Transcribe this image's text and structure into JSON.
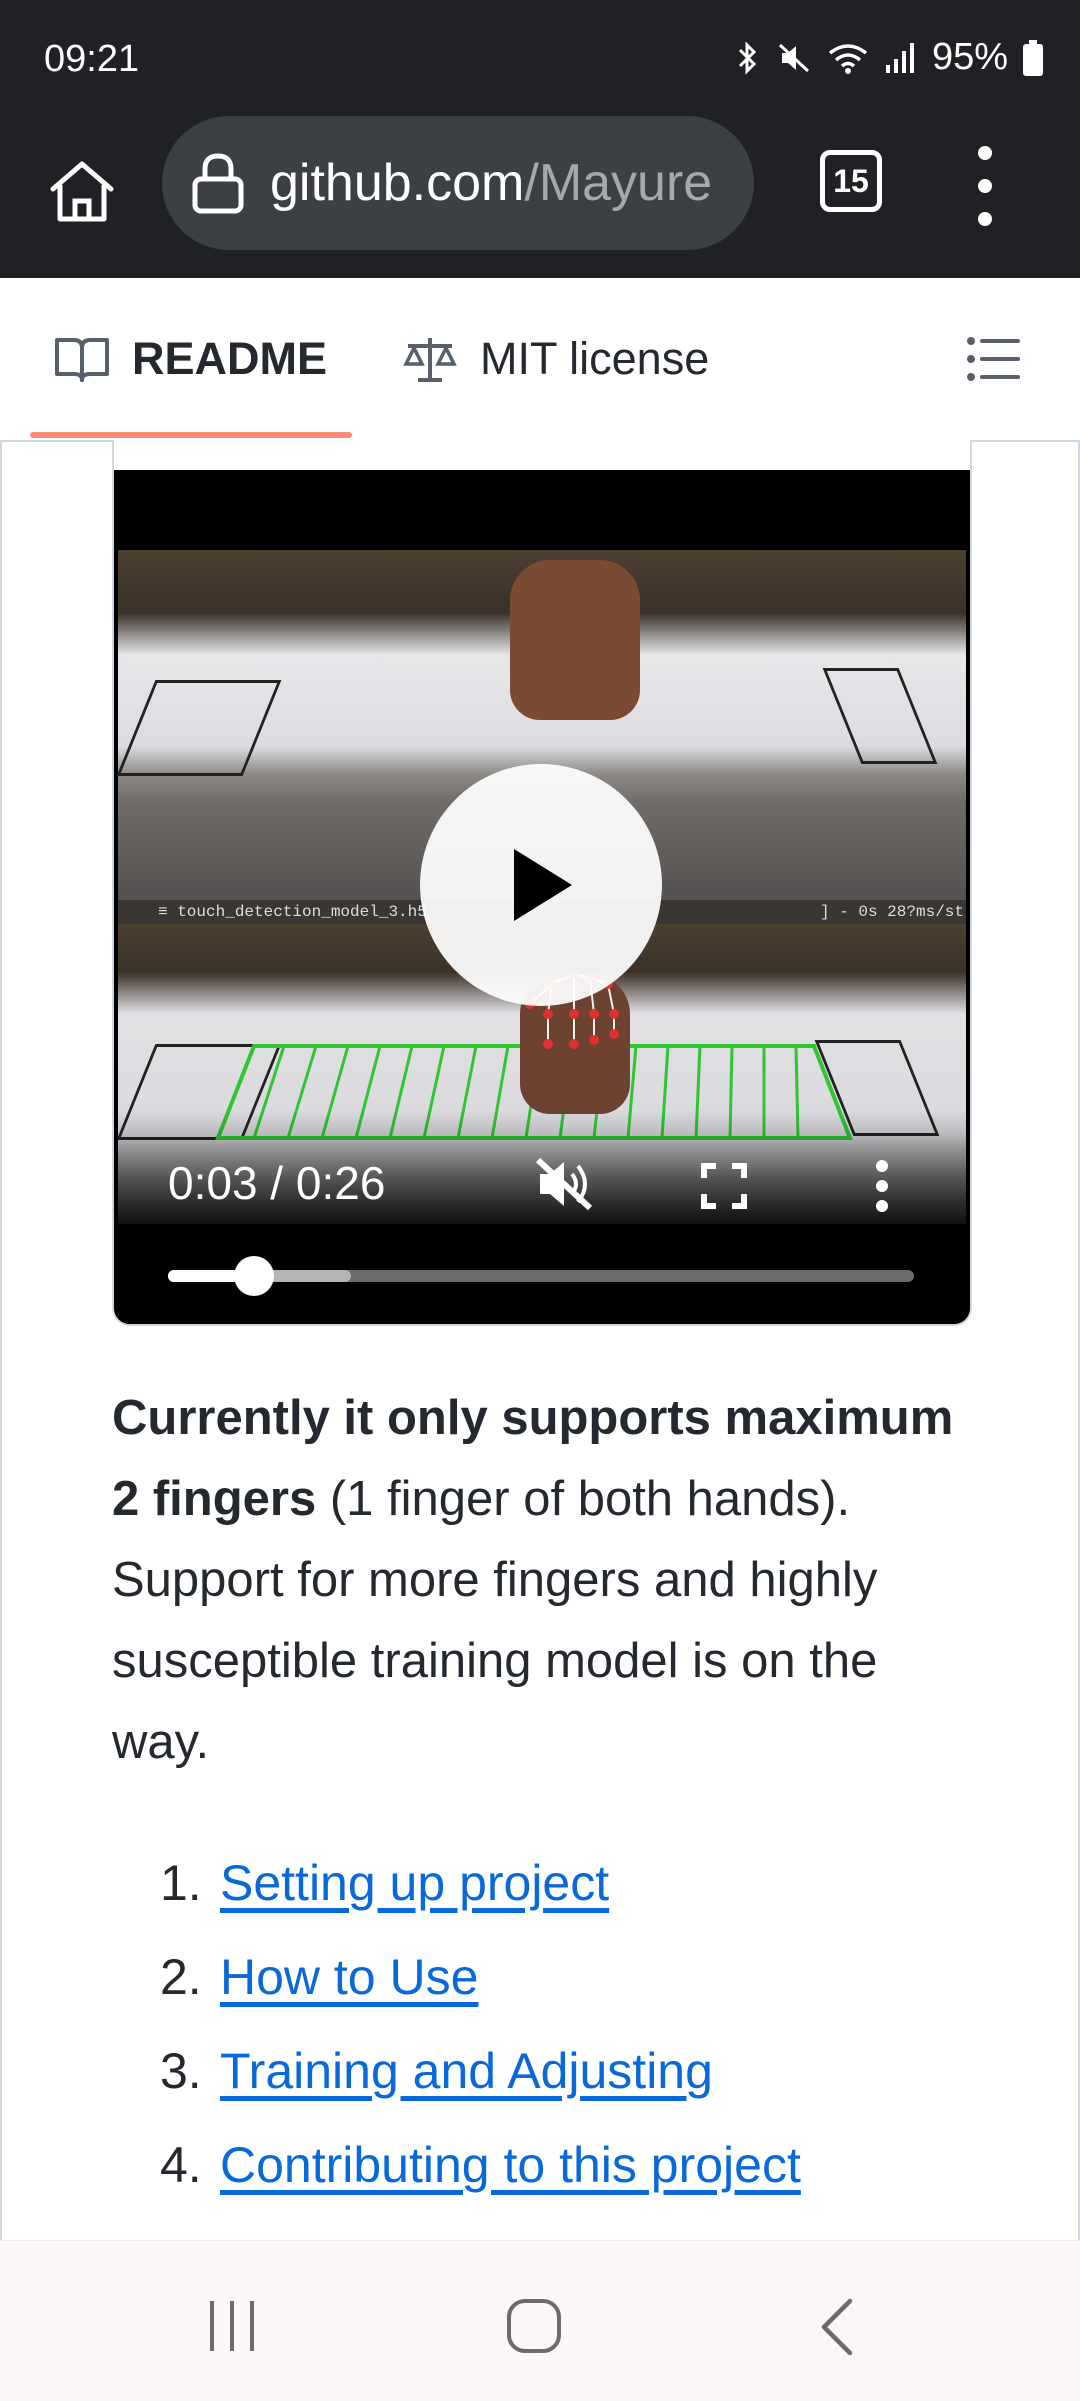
{
  "status_bar": {
    "time": "09:21",
    "battery": "95%",
    "icons": [
      "bluetooth-icon",
      "mute-icon",
      "wifi-icon",
      "signal-icon",
      "battery-icon"
    ]
  },
  "browser": {
    "url_host": "github.com",
    "url_path": "/Mayure",
    "tab_count": "15"
  },
  "readme_tabs": {
    "readme_label": "README",
    "license_label": "MIT license"
  },
  "video": {
    "overlay_text_left": "≡ touch_detection_model_3.h5",
    "overlay_text_right": "] - 0s 28?ms/st",
    "time_readout": "0:03 / 0:26",
    "progress_fraction": 0.115,
    "buffered_fraction": 0.245
  },
  "content": {
    "bold_text": "Currently it only supports maximum 2 fingers",
    "rest_text": " (1 finger of both hands). Support for more fingers and highly susceptible training model is on the way.",
    "toc": [
      {
        "num": "1.",
        "label": "Setting up project"
      },
      {
        "num": "2.",
        "label": "How to Use"
      },
      {
        "num": "3.",
        "label": "Training and Adjusting"
      },
      {
        "num": "4.",
        "label": "Contributing to this project"
      }
    ]
  },
  "colors": {
    "link": "#0969da",
    "tab_underline": "#fd8c73",
    "chrome_dark": "#202124"
  }
}
